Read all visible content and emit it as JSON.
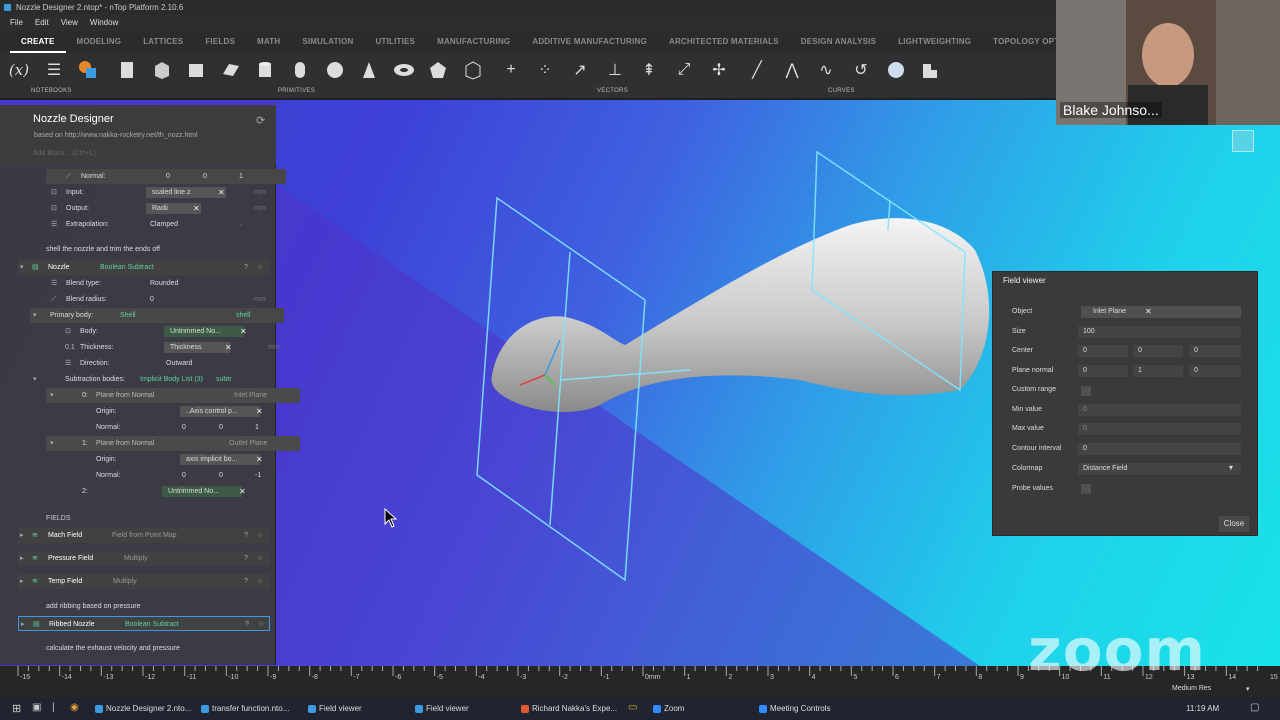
{
  "window": {
    "title": "Nozzle Designer 2.ntop* - nTop Platform 2.10.6"
  },
  "menu": [
    "File",
    "Edit",
    "View",
    "Window"
  ],
  "tabs": [
    "CREATE",
    "MODELING",
    "LATTICES",
    "FIELDS",
    "MATH",
    "SIMULATION",
    "UTILITIES",
    "MANUFACTURING",
    "ADDITIVE MANUFACTURING",
    "ARCHITECTED MATERIALS",
    "DESIGN ANALYSIS",
    "LIGHTWEIGHTING",
    "TOPOLOGY OPTIMI"
  ],
  "toolbar": {
    "fx_label": "(x)",
    "groups": {
      "notebooks": "NOTEBOOKS",
      "primitives": "PRIMITIVES",
      "vectors": "VECTORS",
      "curves": "CURVES"
    }
  },
  "notebook": {
    "title": "Nozzle Designer",
    "subtitle": "based on http://www.nakka-rocketry.net/th_nozz.html",
    "add_block": "Add Block... (Ctrl+L)",
    "normal_row": {
      "label": "Normal:",
      "x": "0",
      "y": "0",
      "z": "1"
    },
    "input_row": {
      "label": "Input:",
      "value": "scaled line.z",
      "unit": "mm"
    },
    "output_row": {
      "label": "Output:",
      "value": "Radii",
      "unit": "mm"
    },
    "extrap_row": {
      "label": "Extrapolation:",
      "value": "Clamped"
    },
    "comment1": "shell the nozzle and trim the ends off",
    "nozzle": {
      "name": "Nozzle",
      "type": "Boolean Subtract"
    },
    "blend_type": {
      "label": "Blend type:",
      "value": "Rounded"
    },
    "blend_radius": {
      "label": "Blend radius:",
      "value": "0",
      "unit": "mm"
    },
    "primary": {
      "label": "Primary body:",
      "type": "Shell",
      "tag": "shell"
    },
    "body": {
      "label": "Body:",
      "value": "Untrimmed No..."
    },
    "thickness": {
      "label": "Thickness:",
      "value": "Thickness",
      "unit": "mm"
    },
    "direction": {
      "label": "Direction:",
      "value": "Outward"
    },
    "subtraction": {
      "label": "Subtraction bodies:",
      "type": "Implicit Body List (3)",
      "tag": "subtr"
    },
    "item0": {
      "index": "0:",
      "name": "Plane from Normal",
      "tag": "Inlet Plane"
    },
    "item0_origin": {
      "label": "Origin:",
      "value": "..Axis control p...",
      "unit": "mm"
    },
    "item0_normal": {
      "label": "Normal:",
      "x": "0",
      "y": "0",
      "z": "1"
    },
    "item1": {
      "index": "1:",
      "name": "Plane from Normal",
      "tag": "Outlet Plane"
    },
    "item1_origin": {
      "label": "Origin:",
      "value": "axis implicit bo...",
      "unit": "mm"
    },
    "item1_normal": {
      "label": "Normal:",
      "x": "0",
      "y": "0",
      "z": "-1"
    },
    "item2": {
      "index": "2:",
      "value": "Untrimmed No..."
    },
    "fields_header": "FIELDS",
    "mach": {
      "name": "Mach Field",
      "type": "Field from Point Map"
    },
    "pressure": {
      "name": "Pressure Field",
      "type": "Multiply"
    },
    "temp": {
      "name": "Temp Field",
      "type": "Multiply"
    },
    "comment2": "add ribbing based on pressure",
    "ribbed": {
      "name": "Ribbed Nozzle",
      "type": "Boolean Subtract"
    },
    "comment3": "calculate the exhaust velocity and pressure"
  },
  "field_viewer": {
    "title": "Field viewer",
    "object": {
      "label": "Object",
      "value": "Inlet Plane"
    },
    "size": {
      "label": "Size",
      "value": "100"
    },
    "center": {
      "label": "Center",
      "x": "0",
      "y": "0",
      "z": "0"
    },
    "plane_normal": {
      "label": "Plane normal",
      "x": "0",
      "y": "1",
      "z": "0"
    },
    "custom_range": {
      "label": "Custom range"
    },
    "min_value": {
      "label": "Min value",
      "value": "0"
    },
    "max_value": {
      "label": "Max value",
      "value": "0"
    },
    "contour": {
      "label": "Contour interval",
      "value": "0"
    },
    "colormap": {
      "label": "Colormap",
      "value": "Distance Field"
    },
    "probe": {
      "label": "Probe values"
    },
    "close": "Close"
  },
  "ruler": {
    "ticks": [
      "-15",
      "-14",
      "-13",
      "-12",
      "-11",
      "-10",
      "-9",
      "-8",
      "-7",
      "-6",
      "-5",
      "-4",
      "-3",
      "-2",
      "-1",
      "0mm",
      "1",
      "2",
      "3",
      "4",
      "5",
      "6",
      "7",
      "8",
      "9",
      "10",
      "11",
      "12",
      "13",
      "14",
      "15"
    ],
    "render_mode": "Medium Res"
  },
  "webcam": {
    "name": "Blake Johnso..."
  },
  "zoom_watermark": "zoom",
  "taskbar": {
    "items": [
      "Nozzle Designer 2.nto...",
      "transfer function.nto...",
      "Field viewer",
      "Field viewer",
      "Richard Nakka's Expe...",
      "Zoom",
      "Meeting Controls"
    ],
    "time": "11:19 AM"
  },
  "colors": {
    "accent": "#5fd1a0",
    "viewport_left": "#3d3fd6",
    "viewport_right": "#19e3e9",
    "wireframe": "#7fe6ff"
  }
}
